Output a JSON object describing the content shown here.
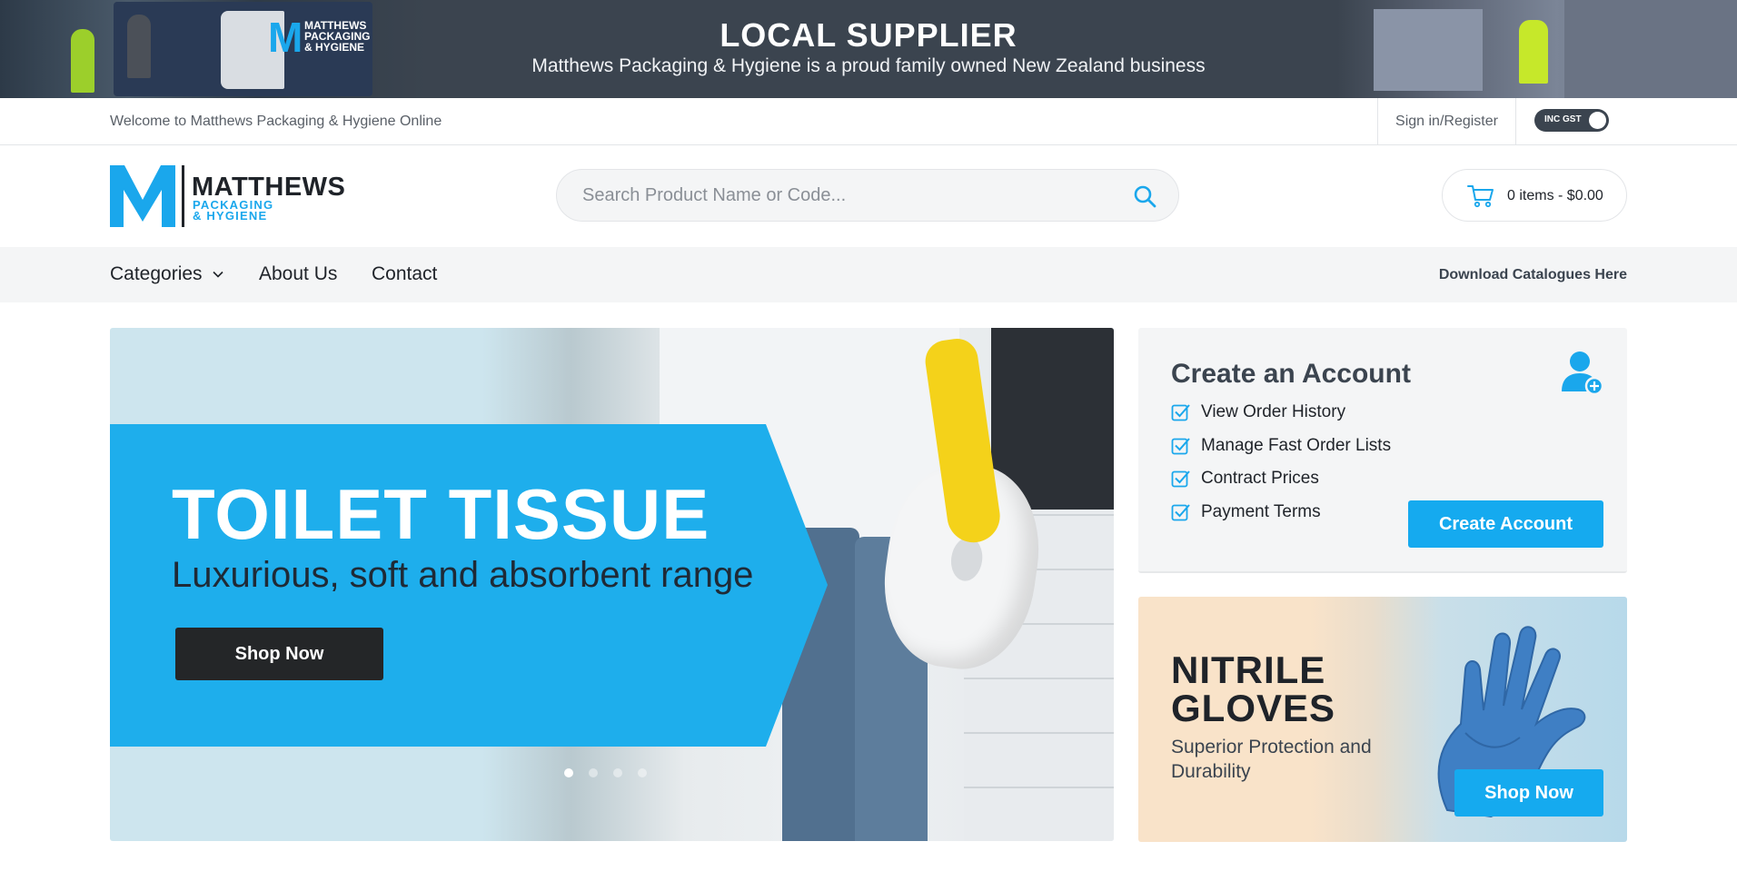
{
  "top_banner": {
    "title": "LOCAL SUPPLIER",
    "subtitle": "Matthews Packaging & Hygiene is a proud family owned New Zealand business",
    "truck_logo_letter": "M",
    "truck_logo_lines": [
      "MATTHEWS",
      "PACKAGING",
      "& HYGIENE"
    ]
  },
  "utility_bar": {
    "welcome": "Welcome to Matthews Packaging & Hygiene Online",
    "sign_in": "Sign in/Register",
    "gst_toggle": "INC GST"
  },
  "header": {
    "logo": {
      "name": "MATTHEWS",
      "sub_line1": "PACKAGING",
      "sub_line2": "& HYGIENE"
    },
    "search_placeholder": "Search Product Name or Code...",
    "search_icon": "search-icon",
    "cart_icon": "cart-icon",
    "cart_text": "0 items - $0.00"
  },
  "nav": {
    "items": [
      {
        "label": "Categories",
        "has_dropdown": true
      },
      {
        "label": "About Us"
      },
      {
        "label": "Contact"
      }
    ],
    "download": "Download Catalogues Here"
  },
  "hero": {
    "title": "TOILET TISSUE",
    "subtitle": "Luxurious, soft and absorbent range",
    "button": "Shop Now",
    "slide_count": 4,
    "active_slide": 1
  },
  "account": {
    "title": "Create an Account",
    "benefits": [
      "View Order History",
      "Manage Fast Order Lists",
      "Contract Prices",
      "Payment Terms"
    ],
    "button": "Create Account"
  },
  "promo": {
    "title_line1": "NITRILE",
    "title_line2": "GLOVES",
    "subtitle": "Superior Protection and Durability",
    "button": "Shop Now"
  },
  "colors": {
    "brand_blue": "#1aa7ec",
    "dark_slate": "#3b444f",
    "button_dark": "#242628",
    "hero_panel": "#1eaeec"
  }
}
